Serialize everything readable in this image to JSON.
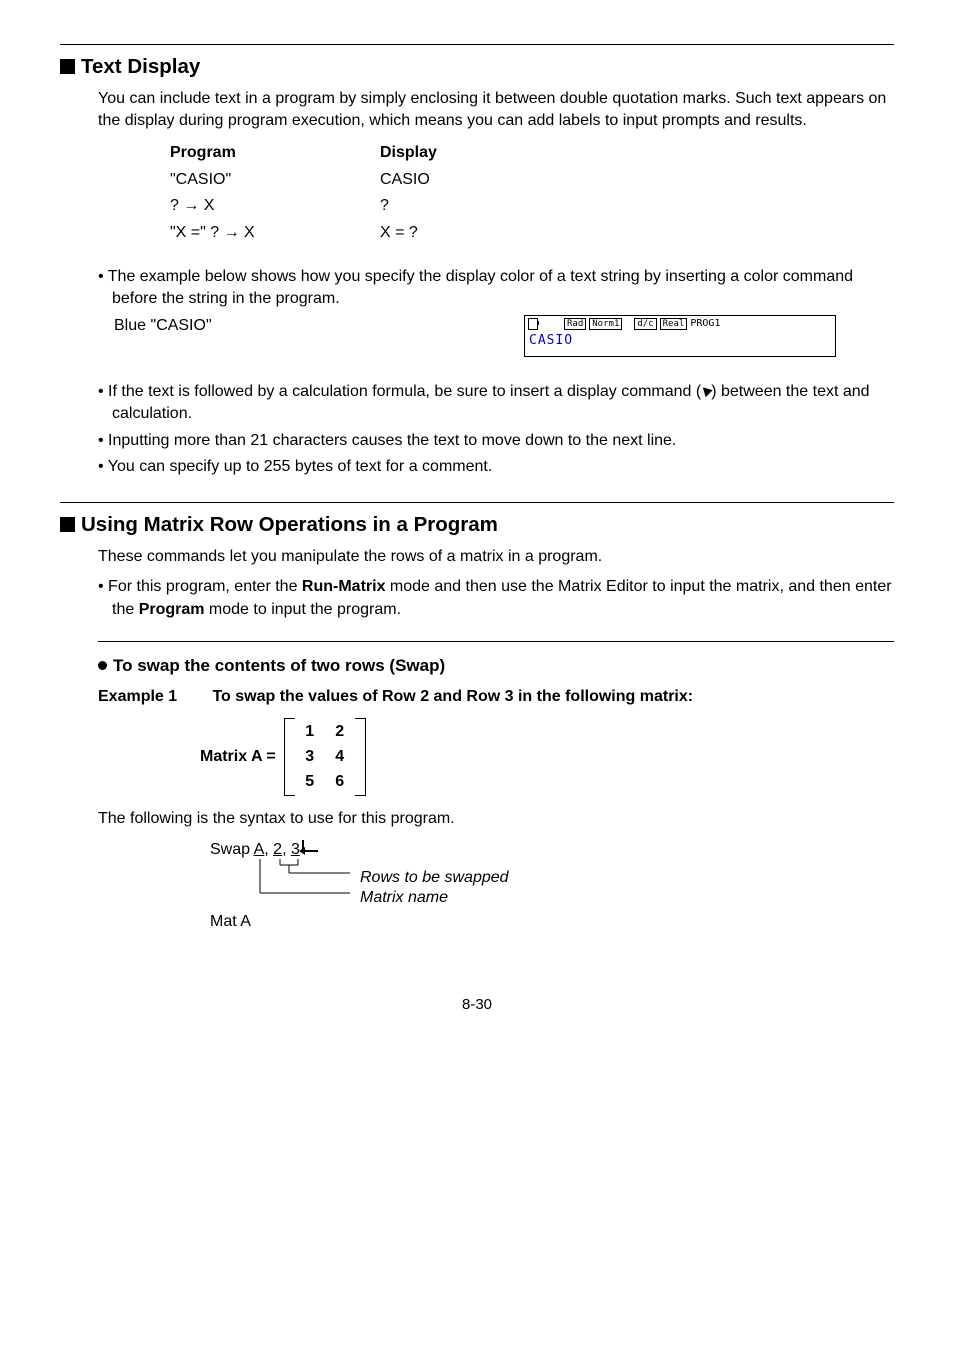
{
  "section1": {
    "heading": "Text Display",
    "intro": "You can include text in a program by simply enclosing it between double quotation marks. Such text appears on the display during program execution, which means you can add labels to input prompts and results.",
    "table": {
      "header": {
        "prog": "Program",
        "disp": "Display"
      },
      "rows": [
        {
          "prog": "\"CASIO\"",
          "disp": "CASIO"
        },
        {
          "prog": "? → X",
          "disp": "?"
        },
        {
          "prog": "\"X =\" ? → X",
          "disp": "X = ?"
        }
      ]
    },
    "example_bullet": "The example below shows how you specify the display color of a text string by inserting a color command before the string in the program.",
    "blue_label": "Blue \"CASIO\"",
    "lcd": {
      "chips": [
        "Rad",
        "Norm1",
        "d/c",
        "Real"
      ],
      "prog": "PROG1",
      "text": "CASIO"
    },
    "bullets2": [
      "If the text is followed by a calculation formula, be sure to insert a display command (    ) between the text and calculation.",
      "Inputting more than 21 characters causes the text to move down to the next line.",
      "You can specify up to 255 bytes of text for a comment."
    ]
  },
  "section2": {
    "heading": "Using Matrix Row Operations in a Program",
    "intro": "These commands let you manipulate the rows of a matrix in a program.",
    "bullet": "For this program, enter the Run-Matrix mode and then use the Matrix Editor to input the matrix, and then enter the Program mode to input the program.",
    "subhead": "To swap the contents of two rows (Swap)",
    "example_label": "Example 1",
    "example_text": "To swap the values of Row 2 and Row 3 in the following matrix:",
    "matrix_label": "Matrix A =",
    "matrix": [
      [
        "1",
        "2"
      ],
      [
        "3",
        "4"
      ],
      [
        "5",
        "6"
      ]
    ],
    "syntax_intro": "The following is the syntax to use for this program.",
    "swap": {
      "cmd_pre": "Swap ",
      "a": "A",
      "sep": ", ",
      "r1": "2",
      "r2": "3",
      "annot1": "Rows to be swapped",
      "annot2": "Matrix name"
    },
    "mat_a": "Mat A",
    "bold_run": "Run-Matrix",
    "bold_prog": "Program"
  },
  "page": "8-30"
}
